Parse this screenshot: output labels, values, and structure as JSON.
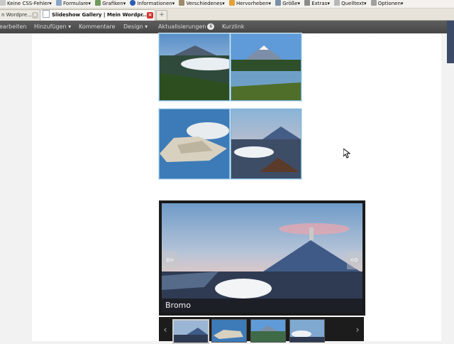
{
  "toolbar": {
    "items": [
      "Keine CSS-Fehler",
      "Formulare",
      "Grafiken",
      "Informationen",
      "Verschiedenes",
      "Hervorheben",
      "Größe",
      "Extras",
      "Quelltext",
      "Optionen"
    ]
  },
  "tabs": {
    "items": [
      {
        "label": "n Wordpre..."
      },
      {
        "label": "Slideshow Gallery | Mein Wordpr..."
      }
    ],
    "new_tab": "+"
  },
  "adminbar": {
    "items": [
      "earbeiten",
      "Hinzufügen",
      "Kommentare",
      "Design",
      "Aktualisierungen",
      "Kurzlink"
    ],
    "updates_count": "6"
  },
  "slideshow": {
    "caption": "Bromo",
    "prev_arrow": "⇦",
    "next_arrow": "⇨",
    "film_prev": "‹",
    "film_next": "›"
  },
  "colors": {
    "adminbar": "#464646",
    "thumb_border": "#7ab3d8",
    "page_bg": "#ffffff"
  }
}
